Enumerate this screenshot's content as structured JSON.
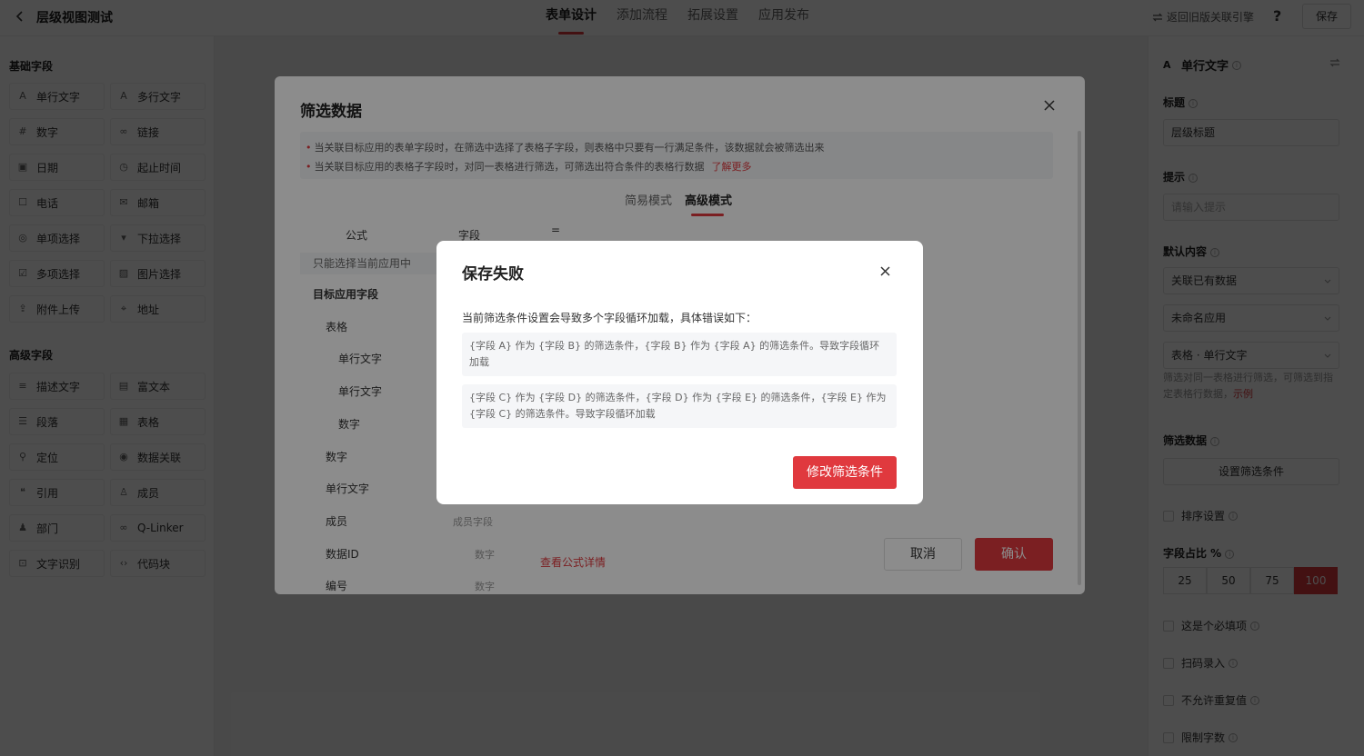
{
  "header": {
    "app_title": "层级视图测试",
    "tabs": [
      {
        "label": "表单设计"
      },
      {
        "label": "添加流程"
      },
      {
        "label": "拓展设置"
      },
      {
        "label": "应用发布"
      }
    ],
    "legacy_link": "返回旧版关联引擎",
    "help": "?",
    "save_label": "保存"
  },
  "left_panel": {
    "basic_title": "基础字段",
    "basic_fields": [
      {
        "icon": "text-icon",
        "glyph": "A",
        "label": "单行文字"
      },
      {
        "icon": "multiline-text-icon",
        "glyph": "A",
        "label": "多行文字"
      },
      {
        "icon": "number-icon",
        "glyph": "#",
        "label": "数字"
      },
      {
        "icon": "link-icon",
        "glyph": "∞",
        "label": "链接"
      },
      {
        "icon": "calendar-icon",
        "glyph": "▣",
        "label": "日期"
      },
      {
        "icon": "clock-icon",
        "glyph": "◷",
        "label": "起止时间"
      },
      {
        "icon": "phone-icon",
        "glyph": "☐",
        "label": "电话"
      },
      {
        "icon": "mail-icon",
        "glyph": "✉",
        "label": "邮箱"
      },
      {
        "icon": "radio-icon",
        "glyph": "◎",
        "label": "单项选择"
      },
      {
        "icon": "dropdown-icon",
        "glyph": "▾",
        "label": "下拉选择"
      },
      {
        "icon": "checkbox-icon",
        "glyph": "☑",
        "label": "多项选择"
      },
      {
        "icon": "image-icon",
        "glyph": "▨",
        "label": "图片选择"
      },
      {
        "icon": "upload-icon",
        "glyph": "⇪",
        "label": "附件上传"
      },
      {
        "icon": "location-icon",
        "glyph": "⌖",
        "label": "地址"
      }
    ],
    "advanced_title": "高级字段",
    "advanced_fields": [
      {
        "icon": "description-icon",
        "glyph": "≡",
        "label": "描述文字"
      },
      {
        "icon": "rich-text-icon",
        "glyph": "▤",
        "label": "富文本"
      },
      {
        "icon": "paragraph-icon",
        "glyph": "☰",
        "label": "段落"
      },
      {
        "icon": "table-icon",
        "glyph": "▦",
        "label": "表格"
      },
      {
        "icon": "position-icon",
        "glyph": "⚲",
        "label": "定位"
      },
      {
        "icon": "data-link-icon",
        "glyph": "◉",
        "label": "数据关联"
      },
      {
        "icon": "quote-icon",
        "glyph": "❝",
        "label": "引用"
      },
      {
        "icon": "member-icon",
        "glyph": "♙",
        "label": "成员"
      },
      {
        "icon": "department-icon",
        "glyph": "♟",
        "label": "部门"
      },
      {
        "icon": "qlinker-icon",
        "glyph": "∞",
        "label": "Q-Linker"
      },
      {
        "icon": "ocr-icon",
        "glyph": "⊡",
        "label": "文字识别"
      },
      {
        "icon": "code-icon",
        "glyph": "‹›",
        "label": "代码块"
      }
    ]
  },
  "right_panel": {
    "field_name": "单行文字",
    "title_label": "标题",
    "title_value": "层级标题",
    "hint_label": "提示",
    "hint_placeholder": "请输入提示",
    "default_label": "默认内容",
    "default_select": "关联已有数据",
    "app_select": "未命名应用",
    "field_select": "表格 · 单行文字",
    "hint_text": "筛选对同一表格进行筛选，可筛选到指定表格行数据，",
    "hint_link": "示例",
    "filter_label": "筛选数据",
    "filter_button": "设置筛选条件",
    "sort_label": "排序设置",
    "ratio_label": "字段占比 %",
    "ratios": [
      "25",
      "50",
      "75",
      "100"
    ],
    "ratio_selected": "100",
    "checks": [
      "这是个必填项",
      "扫码录入",
      "不允许重复值",
      "限制字数"
    ]
  },
  "filter_dialog": {
    "title": "筛选数据",
    "notices": [
      "当关联目标应用的表单字段时，在筛选中选择了表格子字段，则表格中只要有一行满足条件，该数据就会被筛选出来",
      "当关联目标应用的表格子字段时，对同一表格进行筛选，可筛选出符合条件的表格行数据"
    ],
    "learn_more": "了解更多",
    "modes": [
      "简易模式",
      "高级模式"
    ],
    "col_formula": "公式",
    "col_field": "字段",
    "col_eq": "=",
    "restrict_text": "只能选择当前应用中",
    "target_label": "目标应用字段",
    "tree": [
      {
        "label": "表格",
        "type": ""
      },
      {
        "label": "单行文字",
        "type": ""
      },
      {
        "label": "单行文字",
        "type": ""
      },
      {
        "label": "数字",
        "type": ""
      },
      {
        "label": "数字",
        "type": ""
      },
      {
        "label": "单行文字",
        "type": ""
      },
      {
        "label": "成员",
        "type": "成员字段"
      },
      {
        "label": "数据ID",
        "type": "数字"
      },
      {
        "label": "编号",
        "type": "数字"
      }
    ],
    "formula_link": "查看公式详情",
    "cancel_label": "取消",
    "ok_label": "确认"
  },
  "error_dialog": {
    "title": "保存失败",
    "description": "当前筛选条件设置会导致多个字段循环加载，具体错误如下：",
    "errors": [
      "{字段 A} 作为 {字段 B} 的筛选条件，{字段 B} 作为 {字段 A} 的筛选条件。导致字段循环加载",
      "{字段 C} 作为 {字段 D} 的筛选条件，{字段 D} 作为 {字段 E} 的筛选条件，{字段 E} 作为 {字段 C} 的筛选条件。导致字段循环加载"
    ],
    "action_label": "修改筛选条件"
  },
  "colors": {
    "accent": "#e0393e",
    "overlay": "rgba(0,0,0,0.45)"
  }
}
